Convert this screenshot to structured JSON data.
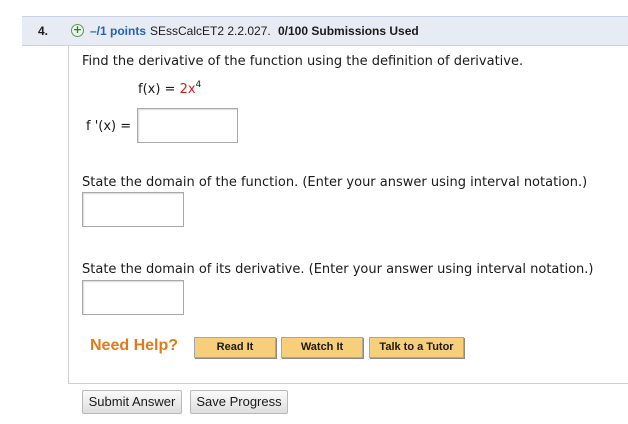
{
  "header": {
    "number": "4.",
    "points": "–/1 points",
    "code": "SEssCalcET2 2.2.027.",
    "submissions": "0/100 Submissions Used"
  },
  "question": {
    "instruction_1": "Find the derivative of the function using the definition of derivative.",
    "function_lhs": "f(x) = ",
    "function_coef": "2x",
    "function_exp": "4",
    "derivative_label": "f '(x) =",
    "instruction_2": "State the domain of the function. (Enter your answer using interval notation.)",
    "instruction_3": "State the domain of its derivative. (Enter your answer using interval notation.)"
  },
  "help": {
    "title": "Need Help?",
    "read": "Read It",
    "watch": "Watch It",
    "tutor": "Talk to a Tutor"
  },
  "actions": {
    "submit": "Submit Answer",
    "save": "Save Progress"
  },
  "colors": {
    "header_bg": "#e7ecf4",
    "points": "#2563b0",
    "help_title": "#e07b1a",
    "help_button": "#f7ce7a",
    "function_red": "#cc1f1f"
  },
  "icons": {
    "expand": "plus-circle-icon"
  }
}
